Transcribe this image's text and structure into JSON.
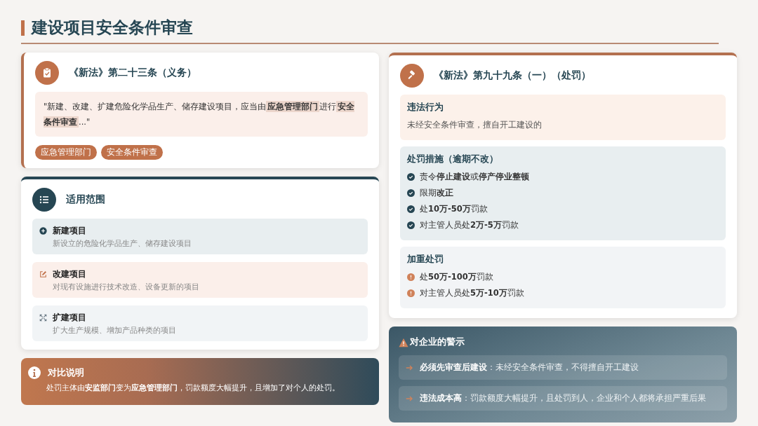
{
  "title": "建设项目安全条件审查",
  "duty": {
    "heading": "《新法》第二十三条（义务）",
    "quote": "\"新建、改建、扩建危险化学品生产、储存建设项目，应当由**应急管理部门**进行**安全条件审查**...\"",
    "tags": [
      "应急管理部门",
      "安全条件审查"
    ]
  },
  "scope": {
    "heading": "适用范围",
    "items": [
      {
        "kind": "new",
        "name": "新建项目",
        "desc": "新设立的危险化学品生产、储存建设项目"
      },
      {
        "kind": "modify",
        "name": "改建项目",
        "desc": "对现有设施进行技术改造、设备更新的项目"
      },
      {
        "kind": "expand",
        "name": "扩建项目",
        "desc": "扩大生产规模、增加产品种类的项目"
      }
    ]
  },
  "note": {
    "heading": "对比说明",
    "text": "处罚主体由**安监部门**变为**应急管理部门**，罚款额度大幅提升，且增加了对个人的处罚。"
  },
  "penalty": {
    "heading": "《新法》第九十九条（一）（处罚）",
    "sections": [
      {
        "kind": "plain",
        "heading": "违法行为",
        "items": [
          "未经安全条件审查，擅自开工建设的"
        ]
      },
      {
        "kind": "check",
        "heading": "处罚措施（逾期不改）",
        "items": [
          "责令**停止建设**或**停产停业整顿**",
          "限期**改正**",
          "处**10万-50万**罚款",
          "对主管人员处**2万-5万**罚款"
        ]
      },
      {
        "kind": "alert",
        "heading": "加重处罚",
        "items": [
          "处**50万-100万**罚款",
          "对主管人员处**5万-10万**罚款"
        ]
      }
    ]
  },
  "warning": {
    "heading": "对企业的警示",
    "items": [
      {
        "label": "必须先审查后建设",
        "text": "：未经安全条件审查，不得擅自开工建设"
      },
      {
        "label": "违法成本高",
        "text": "：罚款额度大幅提升，且处罚到人，企业和个人都将承担严重后果"
      }
    ]
  }
}
